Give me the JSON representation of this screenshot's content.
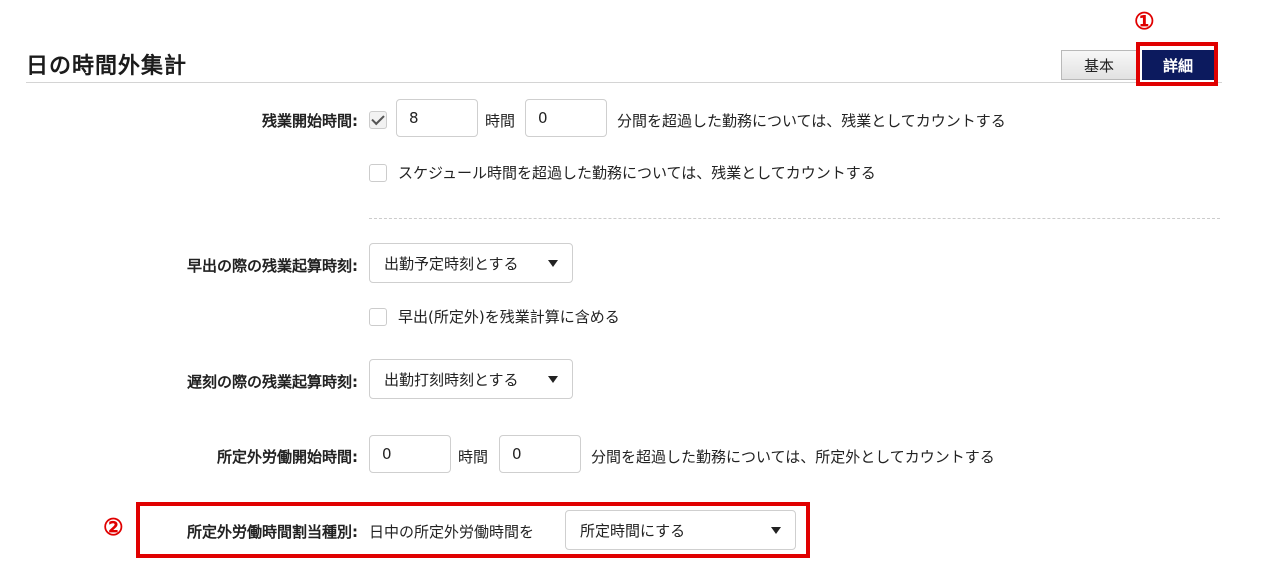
{
  "header": {
    "title": "日の時間外集計"
  },
  "tabs": {
    "basic": "基本",
    "detail": "詳細"
  },
  "markers": {
    "m1": "①",
    "m2": "②"
  },
  "overtime_start": {
    "label": "残業開始時間:",
    "checked": true,
    "hours": "8",
    "hours_unit": "時間",
    "minutes": "0",
    "suffix": "分間を超過した勤務については、残業としてカウントする",
    "schedule_option": "スケジュール時間を超過した勤務については、残業としてカウントする"
  },
  "early_calc": {
    "label": "早出の際の残業起算時刻:",
    "selected": "出勤予定時刻とする",
    "checkbox_label": "早出(所定外)を残業計算に含める"
  },
  "late_calc": {
    "label": "遅刻の際の残業起算時刻:",
    "selected": "出勤打刻時刻とする"
  },
  "non_scheduled_start": {
    "label": "所定外労働開始時間:",
    "hours": "0",
    "hours_unit": "時間",
    "minutes": "0",
    "suffix": "分間を超過した勤務については、所定外としてカウントする"
  },
  "non_scheduled_alloc": {
    "label": "所定外労働時間割当種別:",
    "prefix": "日中の所定外労働時間を",
    "selected": "所定時間にする"
  },
  "colors": {
    "accent_navy": "#0c1a5e",
    "highlight_red": "#e00000"
  }
}
